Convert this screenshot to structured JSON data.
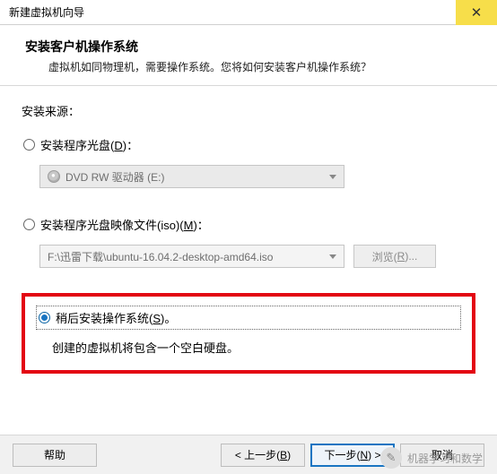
{
  "titlebar": {
    "title": "新建虚拟机向导"
  },
  "header": {
    "title": "安装客户机操作系统",
    "desc": "虚拟机如同物理机，需要操作系统。您将如何安装客户机操作系统？"
  },
  "src_label": "安装来源：",
  "option_disc": {
    "label_pre": "安装程序光盘(",
    "hotkey": "D",
    "label_post": ")：",
    "combo_text": "DVD RW 驱动器 (E:)"
  },
  "option_iso": {
    "label_pre": "安装程序光盘映像文件(iso)(",
    "hotkey": "M",
    "label_post": ")：",
    "path": "F:\\迅雷下载\\ubuntu-16.04.2-desktop-amd64.iso",
    "browse_pre": "浏览(",
    "browse_hot": "R",
    "browse_post": ")..."
  },
  "option_later": {
    "label_pre": "稍后安装操作系统(",
    "hotkey": "S",
    "label_post": ")。",
    "desc": "创建的虚拟机将包含一个空白硬盘。"
  },
  "footer": {
    "help": "帮助",
    "back_pre": "< 上一步(",
    "back_hot": "B",
    "back_post": ")",
    "next_pre": "下一步(",
    "next_hot": "N",
    "next_post": ") >",
    "cancel": "取消"
  },
  "watermark": "机器学习和数学"
}
